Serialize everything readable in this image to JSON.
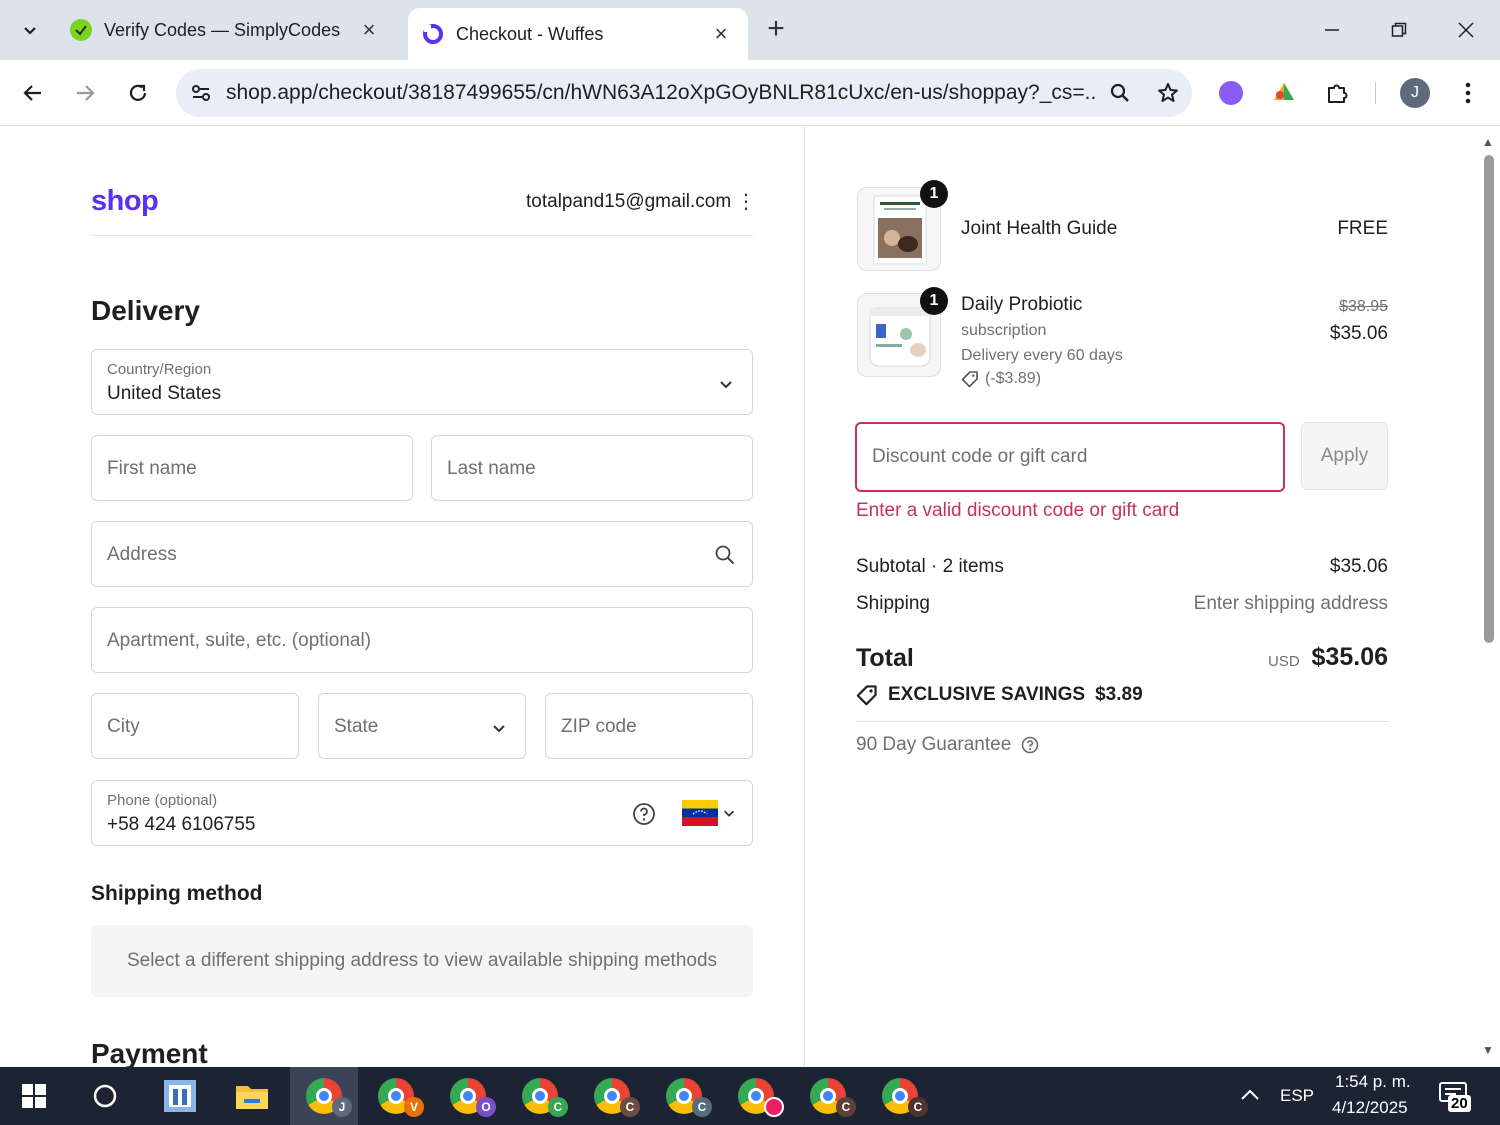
{
  "browser": {
    "tabs": [
      {
        "title": "Verify Codes — SimplyCodes",
        "active": false,
        "favicon": "simplycodes-icon"
      },
      {
        "title": "Checkout - Wuffes",
        "active": true,
        "favicon": "shop-icon"
      }
    ],
    "url": "shop.app/checkout/38187499655/cn/hWN63A12oXpGOyBNLR81cUxc/en-us/shoppay?_cs=...",
    "profile_initial": "J"
  },
  "header": {
    "logo": "shop",
    "email": "totalpand15@gmail.com",
    "menu_glyph": "⋮"
  },
  "delivery": {
    "title": "Delivery",
    "country_label": "Country/Region",
    "country_value": "United States",
    "first_name_placeholder": "First name",
    "last_name_placeholder": "Last name",
    "address_placeholder": "Address",
    "apartment_placeholder": "Apartment, suite, etc. (optional)",
    "city_placeholder": "City",
    "state_placeholder": "State",
    "zip_placeholder": "ZIP code",
    "phone_label": "Phone (optional)",
    "phone_value": "+58 424 6106755"
  },
  "shipping_method": {
    "title": "Shipping method",
    "message": "Select a different shipping address to view available shipping methods"
  },
  "payment": {
    "title": "Payment"
  },
  "order": {
    "items": [
      {
        "name": "Joint Health Guide",
        "quantity": "1",
        "price": "FREE"
      },
      {
        "name": "Daily Probiotic",
        "quantity": "1",
        "meta1": "subscription",
        "meta2": "Delivery every 60 days",
        "discount": "(-$3.89)",
        "original_price": "$38.95",
        "price": "$35.06"
      }
    ],
    "discount_placeholder": "Discount code or gift card",
    "apply_label": "Apply",
    "error": "Enter a valid discount code or gift card",
    "subtotal_label": "Subtotal · 2 items",
    "subtotal_value": "$35.06",
    "shipping_label": "Shipping",
    "shipping_value": "Enter shipping address",
    "total_label": "Total",
    "currency": "USD",
    "total_value": "$35.06",
    "savings_label": "EXCLUSIVE SAVINGS",
    "savings_value": "$3.89",
    "guarantee": "90 Day Guarantee"
  },
  "taskbar": {
    "language": "ESP",
    "time": "1:54 p. m.",
    "date": "4/12/2025",
    "notifications": "20",
    "chrome_profiles": [
      "J",
      "V",
      "O",
      "C",
      "C",
      "C",
      "",
      "C",
      "C"
    ]
  },
  "colors": {
    "brand": "#5a31f4",
    "error": "#c8325a",
    "tabbar": "#dde3ea",
    "taskbar": "#1c2433"
  }
}
